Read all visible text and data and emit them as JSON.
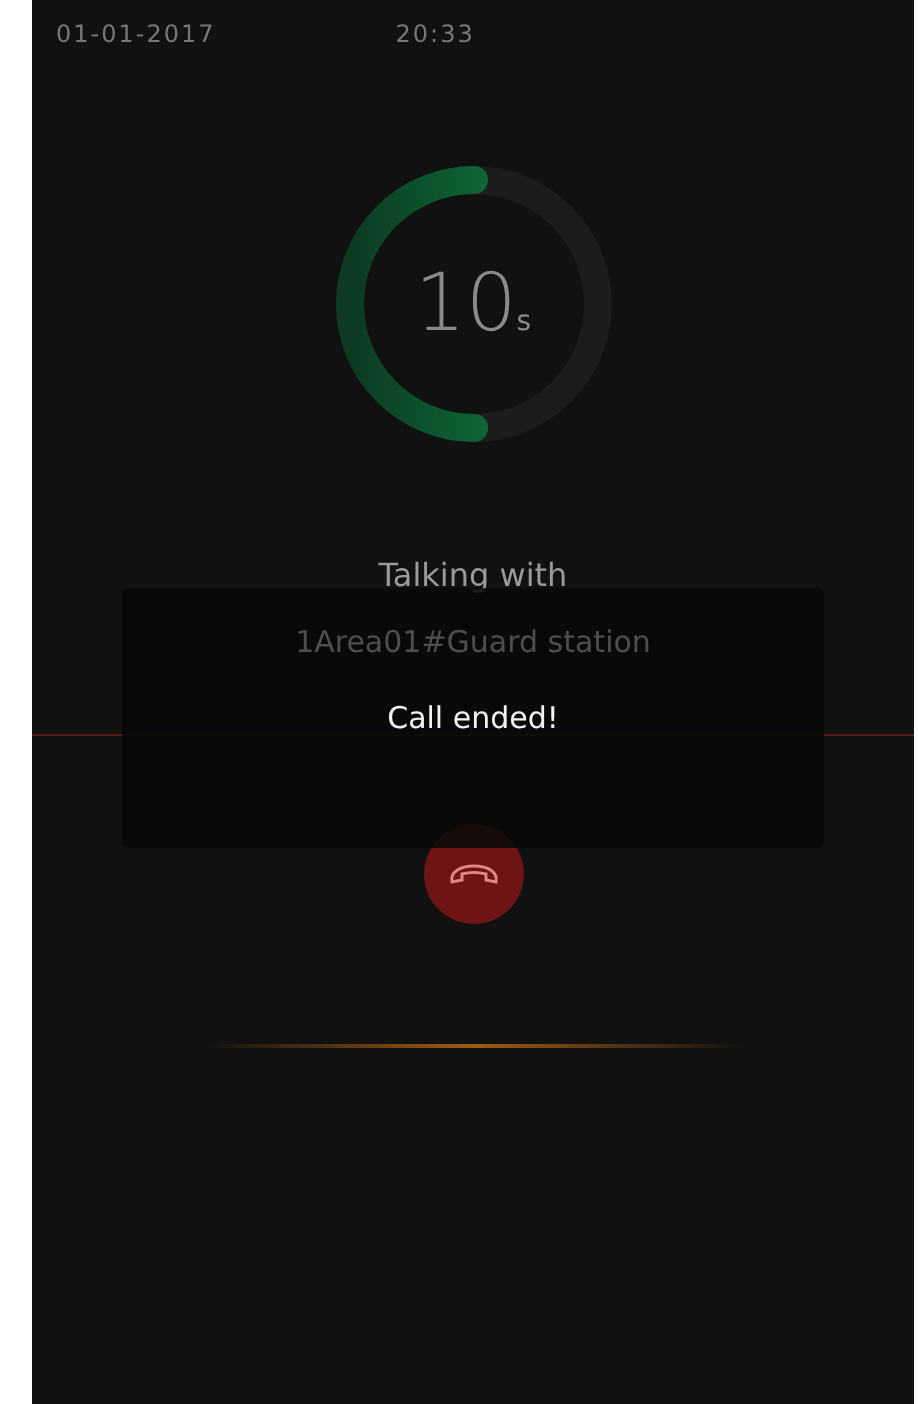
{
  "status_bar": {
    "date": "01-01-2017",
    "time": "20:33"
  },
  "timer": {
    "value": "10",
    "unit": "s",
    "level": 0.5
  },
  "call": {
    "caption": "Talking with",
    "party": "1Area01#Guard station"
  },
  "toast": {
    "message": "Call ended!"
  }
}
